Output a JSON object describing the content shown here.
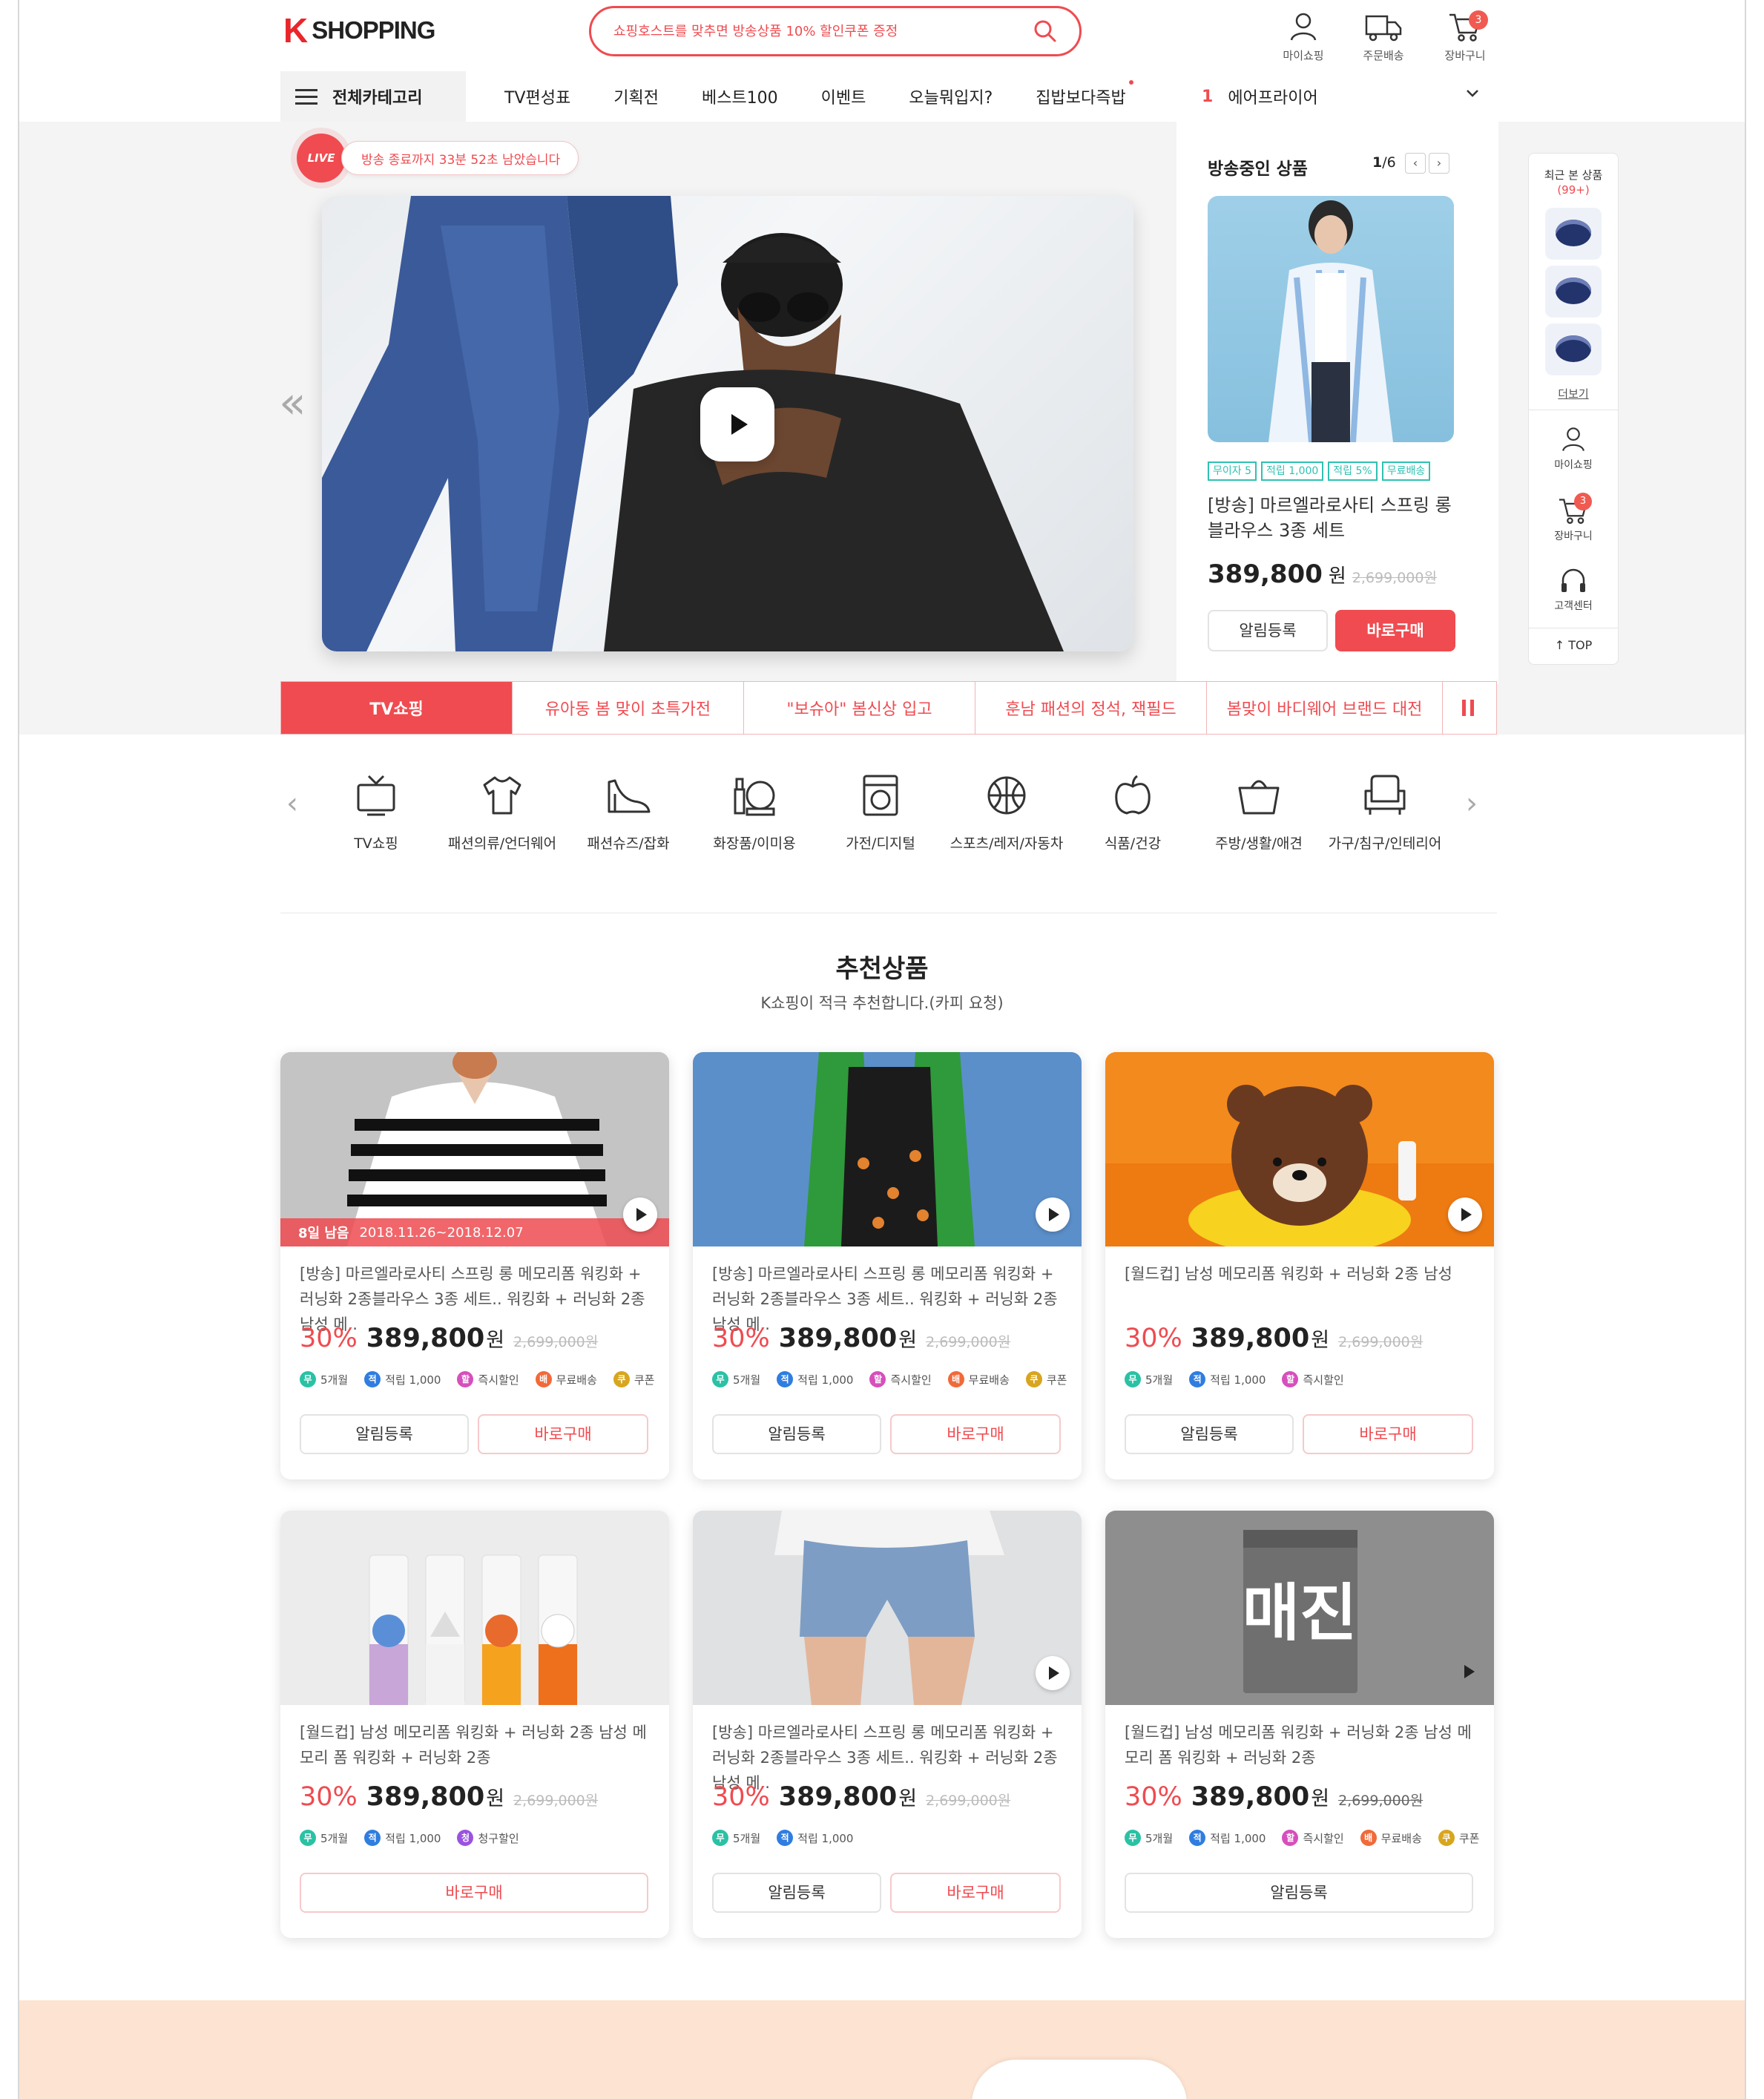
{
  "header": {
    "logo_mark": "K",
    "logo_text": "SHOPPING",
    "search_placeholder": "쇼핑호스트를 맞추면 방송상품 10% 할인쿠폰 증정",
    "icons": [
      {
        "name": "user-icon",
        "label": "마이쇼핑"
      },
      {
        "name": "delivery-truck-icon",
        "label": "주문배송"
      },
      {
        "name": "cart-icon",
        "label": "장바구니",
        "badge": "3"
      }
    ]
  },
  "gnb": {
    "category_label": "전체카테고리",
    "menu": [
      "TV편성표",
      "기획전",
      "베스트100",
      "이벤트",
      "오늘뭐입지?",
      "집밥보다즉밥"
    ],
    "rank_number": "1",
    "rank_keyword": "에어프라이어"
  },
  "hero": {
    "live_label": "LIVE",
    "timer_text": "방송 종료까지 33분 52초 남았습니다",
    "side": {
      "title": "방송중인 상품",
      "page_current": "1",
      "page_total": "/6",
      "tags": [
        "무이자 5",
        "적립 1,000",
        "적립 5%",
        "무료배송"
      ],
      "name": "[방송] 마르엘라로사티 스프링 롱 블라우스 3종 세트",
      "price": "389,800",
      "won": "원",
      "old_price": "2,699,000원",
      "btn_alarm": "알림등록",
      "btn_buy": "바로구매"
    },
    "tabs": [
      "TV쇼핑",
      "유아동 봄 맞이 초특가전",
      "\"보슈아\" 봄신상 입고",
      "훈남 패션의 정석, 잭필드",
      "봄맞이 바디웨어 브랜드 대전"
    ]
  },
  "quick": {
    "title": "최근 본 상품",
    "count": "(99+)",
    "more": "더보기",
    "my": "마이쇼핑",
    "cart": "장바구니",
    "cart_badge": "3",
    "cs": "고객센터",
    "top": "↑ TOP"
  },
  "categories": [
    {
      "icon": "tv-icon",
      "label": "TV쇼핑"
    },
    {
      "icon": "tshirt-icon",
      "label": "패션의류/언더웨어"
    },
    {
      "icon": "high-heel-icon",
      "label": "패션슈즈/잡화"
    },
    {
      "icon": "cosmetics-icon",
      "label": "화장품/이미용"
    },
    {
      "icon": "washing-machine-icon",
      "label": "가전/디지털"
    },
    {
      "icon": "basketball-icon",
      "label": "스포츠/레저/자동차"
    },
    {
      "icon": "apple-icon",
      "label": "식품/건강"
    },
    {
      "icon": "basket-icon",
      "label": "주방/생활/애견"
    },
    {
      "icon": "armchair-icon",
      "label": "가구/침구/인테리어"
    }
  ],
  "recommend": {
    "title": "추천상품",
    "subtitle": "K쇼핑이 적극 추천합니다.(카피 요청)",
    "alarm_label": "알림등록",
    "buy_label": "바로구매",
    "discount": "30%",
    "price": "389,800",
    "won": "원",
    "old_price": "2,699,000원",
    "sold_out": "매진",
    "dday": "8일 남음",
    "dday_period": "2018.11.26~2018.12.07",
    "names": {
      "a": "[방송] 마르엘라로사티 스프링 롱 메모리폼 워킹화 + 러닝화 2종블라우스 3종 세트.. 워킹화 + 러닝화 2종 남성 메..",
      "b": "[월드컵] 남성 메모리폼 워킹화 + 러닝화 2종 남성",
      "c": "[월드컵] 남성 메모리폼 워킹화 + 러닝화 2종 남성 메모리 폼 워킹화 + 러닝화 2종"
    },
    "benefits": {
      "free": {
        "mark": "무",
        "label": "5개월"
      },
      "point": {
        "mark": "적",
        "label": "적립 1,000"
      },
      "instant": {
        "mark": "할",
        "label": "즉시할인"
      },
      "claim": {
        "mark": "청",
        "label": "청구할인"
      },
      "ship": {
        "mark": "배",
        "label": "무료배송"
      },
      "coupon": {
        "mark": "쿠",
        "label": "쿠폰"
      }
    }
  }
}
